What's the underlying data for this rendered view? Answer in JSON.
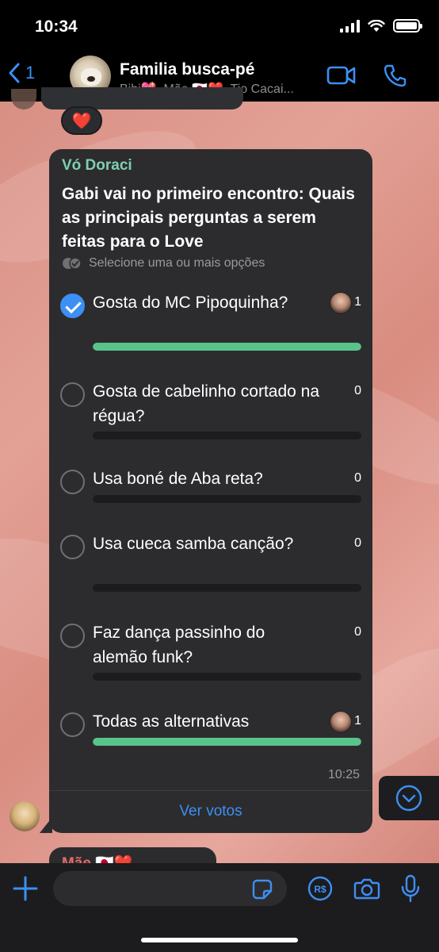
{
  "status_bar": {
    "time": "10:34"
  },
  "header": {
    "back_count": "1",
    "group_name": "Familia busca-pé",
    "members": "Bibi💖, Mãe 🇯🇵❤️, Tio Cacai..."
  },
  "reaction": {
    "emoji": "❤️"
  },
  "poll": {
    "sender": "Vó Doraci",
    "question": "Gabi vai no primeiro encontro: Quais as principais perguntas a serem feitas para o Love",
    "hint": "Selecione uma ou mais opções",
    "options": [
      {
        "label": "Gosta do MC Pipoquinha?",
        "votes": "1",
        "checked": true,
        "fill": 1.0
      },
      {
        "label": "Gosta de cabelinho cortado na régua?",
        "votes": "0",
        "checked": false,
        "fill": 0.0
      },
      {
        "label": "Usa boné de Aba reta?",
        "votes": "0",
        "checked": false,
        "fill": 0.0
      },
      {
        "label": "Usa cueca samba canção?",
        "votes": "0",
        "checked": false,
        "fill": 0.0
      },
      {
        "label": "Faz dança passinho do alemão funk?",
        "votes": "0",
        "checked": false,
        "fill": 0.0
      },
      {
        "label": "Todas as alternativas",
        "votes": "1",
        "checked": false,
        "fill": 1.0
      }
    ],
    "time": "10:25",
    "view_votes": "Ver votos"
  },
  "next_message": {
    "sender": "Mãe 🇯🇵❤️"
  },
  "composer": {
    "placeholder": ""
  },
  "colors": {
    "accent": "#3d8ff3",
    "poll_bar": "#58c48a",
    "sender_name": "#7fcfb1",
    "bubble": "#2c2c2e"
  }
}
